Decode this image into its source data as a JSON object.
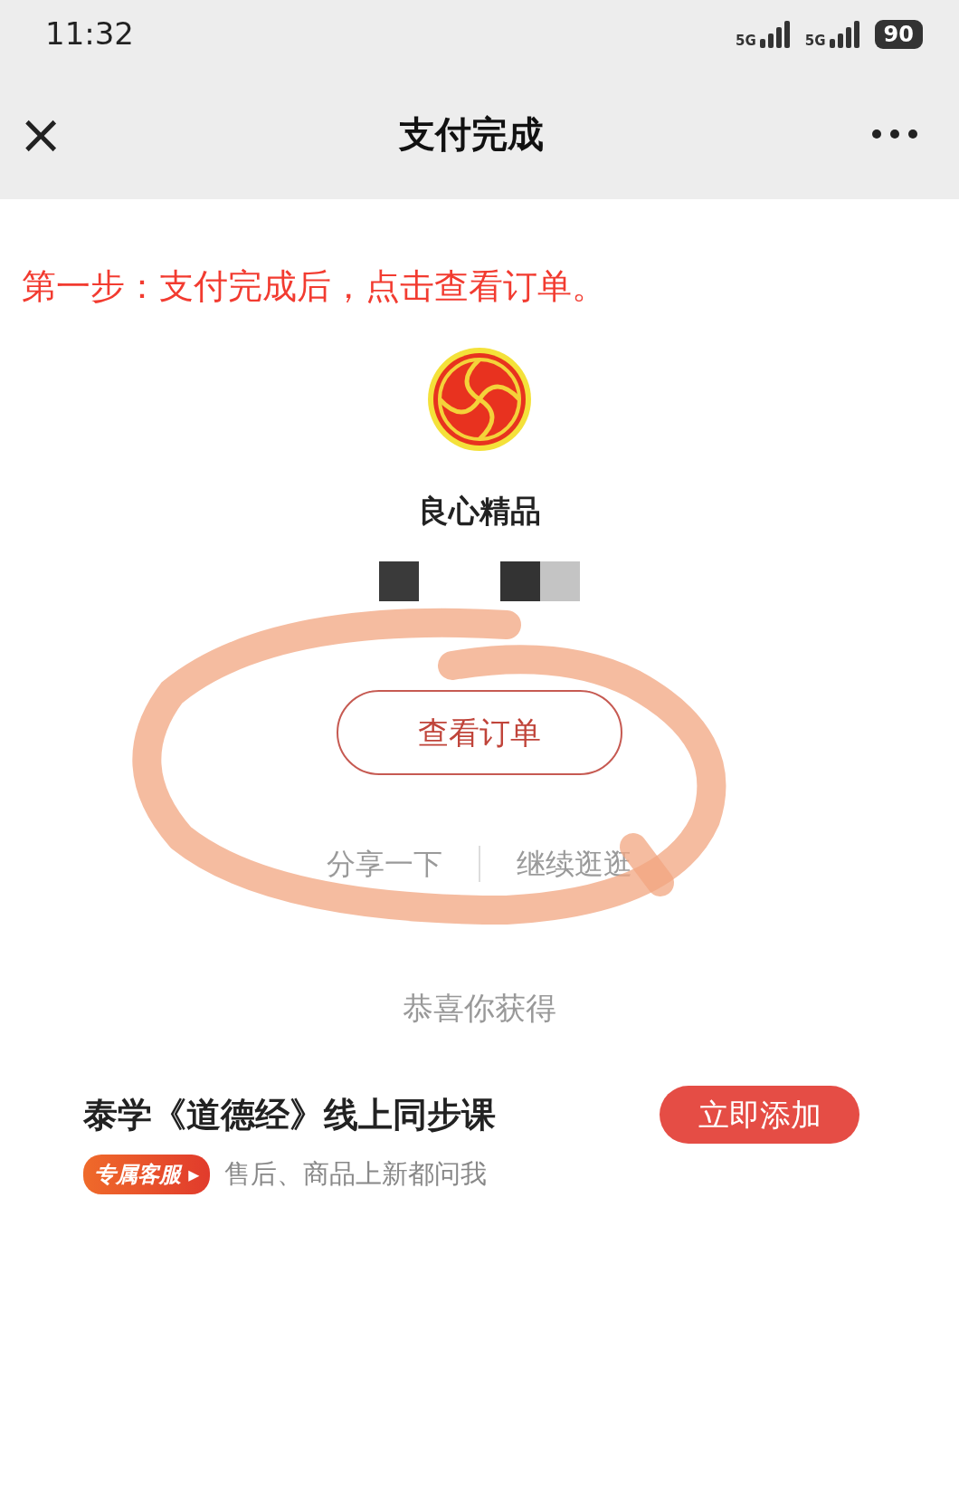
{
  "status_bar": {
    "time": "11:32",
    "networks": [
      "5G",
      "5G"
    ],
    "battery": "90"
  },
  "nav": {
    "title": "支付完成",
    "close": "×"
  },
  "annotation": {
    "instruction": "第一步：支付完成后，点击查看订单。"
  },
  "shop": {
    "name": "良心精品"
  },
  "actions": {
    "primary": "查看订单",
    "links": [
      "分享一下",
      "继续逛逛"
    ]
  },
  "reward": {
    "heading": "恭喜你获得",
    "course": "泰学《道德经》线上同步课",
    "add_button": "立即添加",
    "tag": "专属客服",
    "tag_arrow": "▸",
    "note": "售后、商品上新都问我"
  }
}
